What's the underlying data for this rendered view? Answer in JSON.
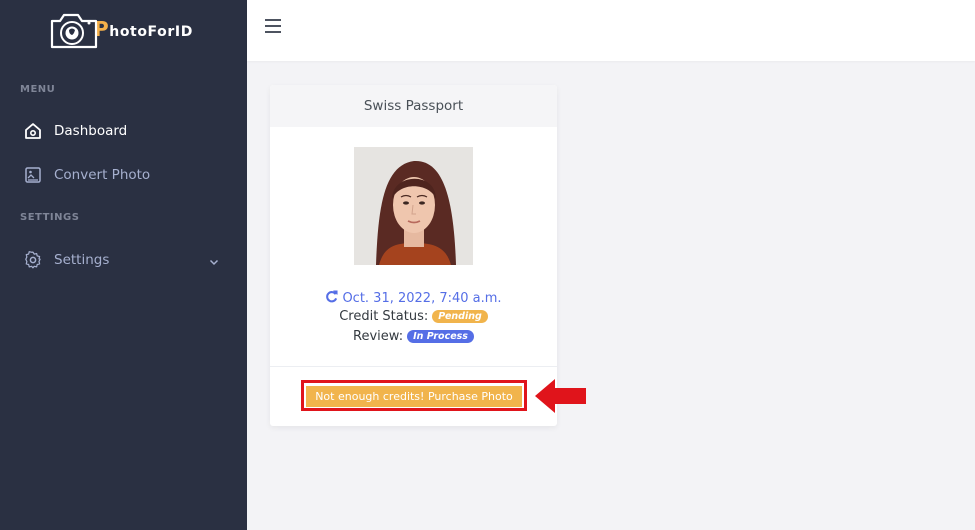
{
  "app": {
    "logo_first_letter": "P",
    "logo_rest": "hotoForID"
  },
  "sidebar": {
    "menu_title": "MENU",
    "settings_title": "SETTINGS",
    "items": [
      {
        "label": "Dashboard",
        "icon": "home-icon"
      },
      {
        "label": "Convert Photo",
        "icon": "image-icon"
      },
      {
        "label": "Settings",
        "icon": "gear-icon"
      }
    ]
  },
  "card": {
    "title": "Swiss Passport",
    "date": "Oct. 31, 2022, 7:40 a.m.",
    "credit_status_label": "Credit Status:",
    "credit_status_value": "Pending",
    "review_label": "Review:",
    "review_value": "In Process",
    "purchase_label": "Not enough credits! Purchase Photo"
  },
  "colors": {
    "sidebar_bg": "#2a3042",
    "accent_blue": "#556ee6",
    "warning": "#f1b44c",
    "highlight_red": "#e0141b"
  }
}
